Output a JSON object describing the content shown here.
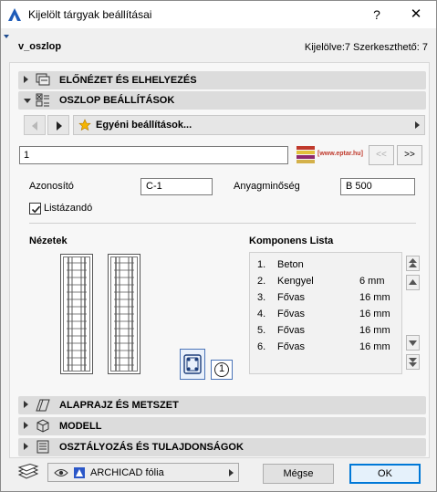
{
  "window": {
    "title": "Kijelölt tárgyak beállításai",
    "help_label": "?",
    "close_label": "✕"
  },
  "header": {
    "element_name": "v_oszlop",
    "selection_info": "Kijelölve:7 Szerkeszthető: 7"
  },
  "sections": {
    "preview": "ELŐNÉZET ÉS ELHELYEZÉS",
    "column_settings": "OSZLOP BEÁLLÍTÁSOK",
    "floorplan": "ALAPRAJZ ÉS METSZET",
    "model": "MODELL",
    "classification": "OSZTÁLYOZÁS ÉS TULAJDONSÁGOK"
  },
  "favorites": {
    "label": "Egyéni beállítások..."
  },
  "library": {
    "name_value": "1",
    "logo_text": "[www.eptar.hu]",
    "prev_label": "<<",
    "next_label": ">>"
  },
  "fields": {
    "id_label": "Azonosító",
    "id_value": "C-1",
    "material_label": "Anyagminőség",
    "material_value": "B 500",
    "listed_label": "Listázandó",
    "listed_checked": true
  },
  "views": {
    "heading": "Nézetek",
    "section_number": "1"
  },
  "components": {
    "heading": "Komponens Lista",
    "rows": [
      {
        "num": "1.",
        "name": "Beton",
        "size": ""
      },
      {
        "num": "2.",
        "name": "Kengyel",
        "size": "6 mm"
      },
      {
        "num": "3.",
        "name": "Fővas",
        "size": "16 mm"
      },
      {
        "num": "4.",
        "name": "Fővas",
        "size": "16 mm"
      },
      {
        "num": "5.",
        "name": "Fővas",
        "size": "16 mm"
      },
      {
        "num": "6.",
        "name": "Fővas",
        "size": "16 mm"
      }
    ]
  },
  "footer": {
    "layer_label": "ARCHICAD fólia",
    "cancel_label": "Mégse",
    "ok_label": "OK"
  },
  "colors": {
    "accent": "#0078d7",
    "section_bg": "#dcdcdc",
    "layer_square": "#2b57c8"
  }
}
